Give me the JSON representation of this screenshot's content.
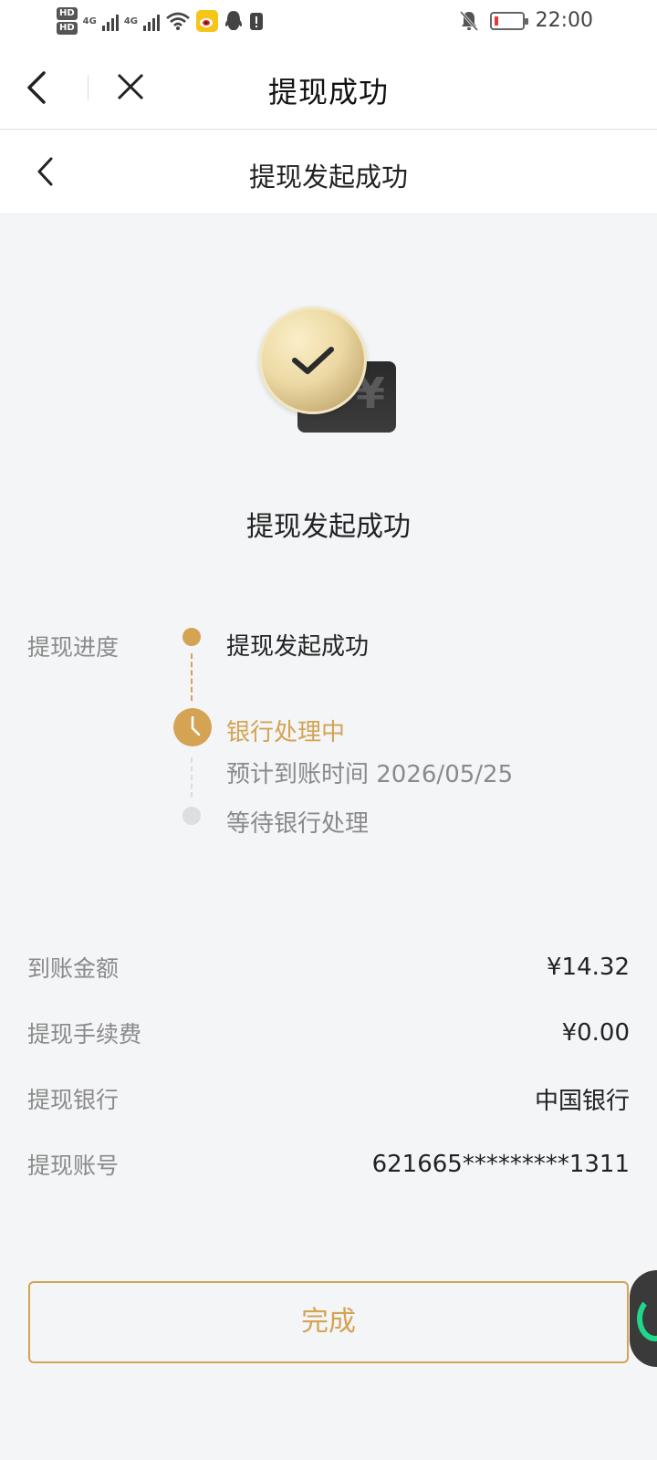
{
  "status_bar": {
    "hd1": "HD",
    "hd2": "HD",
    "net1": "4G",
    "net2": "4G",
    "time": "22:00",
    "icons": [
      "hd-icon",
      "signal-icon",
      "wifi-icon",
      "weibo-icon",
      "qq-icon",
      "alert-icon",
      "mute-bell-icon",
      "battery-icon"
    ]
  },
  "webview_nav": {
    "title": "提现成功"
  },
  "page_nav": {
    "title": "提现发起成功"
  },
  "hero": {
    "icon": "success-coin-wallet-icon",
    "currency_glyph": "¥",
    "message": "提现发起成功"
  },
  "progress": {
    "label": "提现进度",
    "steps": [
      {
        "text": "提现发起成功"
      },
      {
        "text": "银行处理中",
        "eta": "预计到账时间 2026/05/25"
      },
      {
        "text": "等待银行处理"
      }
    ]
  },
  "details": [
    {
      "key": "到账金额",
      "value": "¥14.32"
    },
    {
      "key": "提现手续费",
      "value": "¥0.00"
    },
    {
      "key": "提现银行",
      "value": "中国银行"
    },
    {
      "key": "提现账号",
      "value": "621665*********1311"
    }
  ],
  "actions": {
    "done_label": "完成"
  },
  "colors": {
    "accent": "#d4a354",
    "background": "#f4f5f7",
    "text_secondary": "#8a8a8a",
    "float_green": "#1fd88a"
  }
}
